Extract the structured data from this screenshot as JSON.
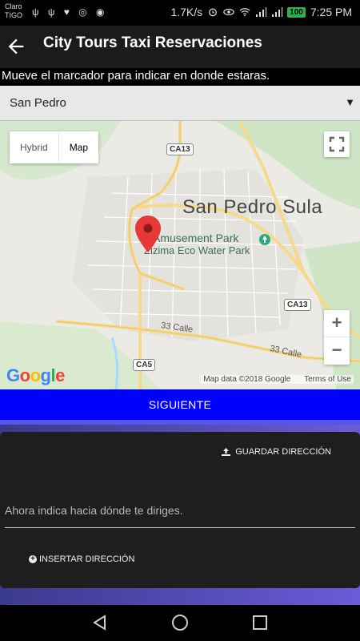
{
  "status_bar": {
    "carrier_line1": "Claro",
    "carrier_line2": "TIGO",
    "left_icons": "ψ ψ ♥ ◎ ◉",
    "net_speed": "1.7K/s",
    "battery": "100",
    "time": "7:25 PM"
  },
  "app_bar": {
    "title": "City Tours Taxi Reservaciones",
    "back_icon": "arrow-left-icon"
  },
  "instruction": "Mueve el marcador para indicar en donde estaras.",
  "location_select": {
    "value": "San Pedro"
  },
  "map": {
    "type_buttons": [
      "Hybrid",
      "Map"
    ],
    "selected_type": "Map",
    "city": "San Pedro Sula",
    "poi_1": "Amusement Park",
    "poi_2": "Zizima Eco Water Park",
    "shields": [
      "CA13",
      "CA13",
      "CA5"
    ],
    "road_1": "33 Calle",
    "road_2": "33 Calle",
    "zoom_in": "+",
    "zoom_out": "−",
    "logo": "Google",
    "attribution": "Map data ©2018 Google",
    "terms": "Terms of Use"
  },
  "next_button": "SIGUIENTE",
  "card": {
    "save_address": "GUARDAR DIRECCIÓN",
    "destination_placeholder": "Ahora indica hacia dónde te diriges.",
    "insert_address": "INSERTAR DIRECCIÓN"
  },
  "colors": {
    "next_button": "#0000ff",
    "pin": "#e53935"
  }
}
